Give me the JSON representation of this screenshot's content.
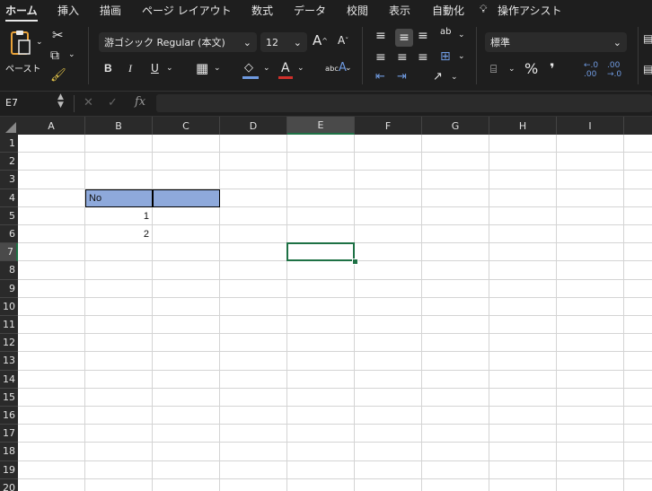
{
  "tabs": [
    "ホーム",
    "挿入",
    "描画",
    "ページ レイアウト",
    "数式",
    "データ",
    "校閲",
    "表示",
    "自動化",
    "操作アシスト"
  ],
  "ribbon": {
    "paste_label": "ペースト",
    "font_name": "游ゴシック Regular (本文)",
    "font_size": "12",
    "bold": "B",
    "italic": "I",
    "underline": "U",
    "number_format": "標準",
    "grow_font": "A",
    "shrink_font": "A",
    "percent": "%",
    "comma": "❜"
  },
  "formula_bar": {
    "name_box": "E7",
    "fx": "fx",
    "content": ""
  },
  "columns": [
    "A",
    "B",
    "C",
    "D",
    "E",
    "F",
    "G",
    "H",
    "I"
  ],
  "rows": [
    "1",
    "2",
    "3",
    "4",
    "5",
    "6",
    "7",
    "8",
    "9",
    "10",
    "11",
    "12",
    "13",
    "14",
    "15",
    "16",
    "17",
    "18",
    "19",
    "20"
  ],
  "selected": {
    "column": "E",
    "row": "7"
  },
  "cells": {
    "B4": "No",
    "B5": "1",
    "B6": "2"
  },
  "colors": {
    "header_fill": "#8ea9db",
    "selection": "#1e7145",
    "font_red": "#d0302b",
    "highlight_blue": "#6f9ae0"
  }
}
